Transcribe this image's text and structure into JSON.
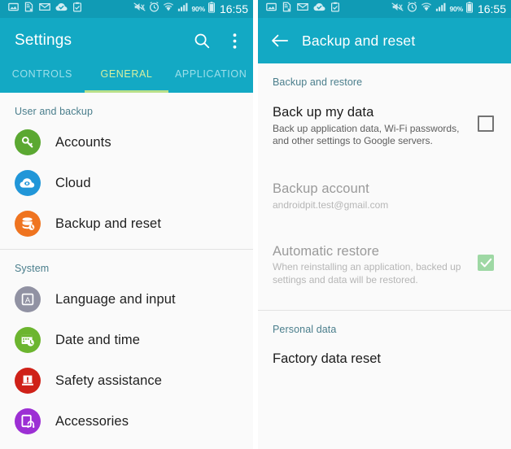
{
  "status_bar": {
    "battery_percent": "90%",
    "clock": "16:55",
    "icons": [
      "image-icon",
      "document-error-icon",
      "email-icon",
      "cloud-check-icon",
      "clipboard-check-icon",
      "mute-icon",
      "alarm-icon",
      "wifi-icon",
      "signal-icon",
      "battery-icon"
    ]
  },
  "left_screen": {
    "title": "Settings",
    "actions": [
      "search-icon",
      "overflow-menu-icon"
    ],
    "tabs": [
      {
        "label": "CONTROLS",
        "active": false
      },
      {
        "label": "GENERAL",
        "active": true
      },
      {
        "label": "APPLICATION",
        "active": false
      }
    ],
    "sections": [
      {
        "label": "User and backup",
        "items": [
          {
            "label": "Accounts",
            "icon": "key-icon",
            "color": "#5ba832"
          },
          {
            "label": "Cloud",
            "icon": "cloud-sync-icon",
            "color": "#2196d8"
          },
          {
            "label": "Backup and reset",
            "icon": "database-restore-icon",
            "color": "#ef7420"
          }
        ]
      },
      {
        "label": "System",
        "items": [
          {
            "label": "Language and input",
            "icon": "letter-a-icon",
            "color": "#9192a3"
          },
          {
            "label": "Date and time",
            "icon": "calendar-clock-icon",
            "color": "#6cb52f"
          },
          {
            "label": "Safety assistance",
            "icon": "warning-icon",
            "color": "#cf2118"
          },
          {
            "label": "Accessories",
            "icon": "headset-device-icon",
            "color": "#9c2fd4"
          }
        ]
      }
    ]
  },
  "right_screen": {
    "back": "back-arrow-icon",
    "title": "Backup and reset",
    "sections": [
      {
        "label": "Backup and restore",
        "items": [
          {
            "title": "Back up my data",
            "subtitle": "Back up application data, Wi-Fi passwords, and other settings to Google servers.",
            "checkbox": "unchecked",
            "dim": false
          },
          {
            "title": "Backup account",
            "subtitle": "androidpit.test@gmail.com",
            "checkbox": "none",
            "dim": true
          },
          {
            "title": "Automatic restore",
            "subtitle": "When reinstalling an application, backed up settings and data will be restored.",
            "checkbox": "checked",
            "dim": true
          }
        ]
      },
      {
        "label": "Personal data",
        "items": [
          {
            "title": "Factory data reset",
            "subtitle": "",
            "checkbox": "none",
            "dim": false
          }
        ]
      }
    ]
  },
  "colors": {
    "accent": "#13a9c4",
    "status_bar": "#109bb5",
    "tab_active": "#d6efa0",
    "tab_inactive": "#9ddfea",
    "section_label": "#4a7e8c",
    "checkbox_checked": "#9ed8a4",
    "background": "#fafafa"
  }
}
